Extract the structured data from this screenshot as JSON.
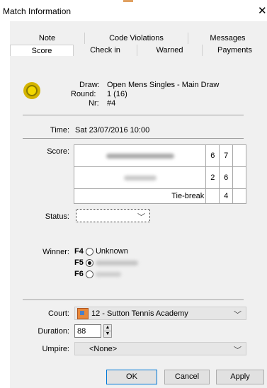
{
  "window": {
    "title": "Match Information",
    "close_glyph": "✕"
  },
  "tabs_row1": [
    {
      "label": "Note"
    },
    {
      "label": "Code Violations"
    },
    {
      "label": "Messages"
    }
  ],
  "tabs_row2": [
    {
      "label": "Score",
      "selected": true
    },
    {
      "label": "Check in"
    },
    {
      "label": "Warned"
    },
    {
      "label": "Payments"
    }
  ],
  "header": {
    "draw_label": "Draw:",
    "draw_value": "Open Mens Singles - Main Draw",
    "round_label": "Round:",
    "round_value": "1 (16)",
    "nr_label": "Nr:",
    "nr_value": "#4",
    "ball_icon": "tennis-ball-icon"
  },
  "time": {
    "label": "Time:",
    "value": "Sat 23/07/2016 10:00"
  },
  "score": {
    "label": "Score:",
    "rows": [
      {
        "set1": "6",
        "set2": "7",
        "set3": ""
      },
      {
        "set1": "2",
        "set2": "6",
        "set3": ""
      }
    ],
    "tiebreak_label": "Tie-break",
    "tiebreak_values": [
      "",
      "4",
      ""
    ]
  },
  "status": {
    "label": "Status:",
    "value": ""
  },
  "winner": {
    "label": "Winner:",
    "options": [
      {
        "key": "F4",
        "text": "Unknown",
        "checked": false
      },
      {
        "key": "F5",
        "text": "",
        "checked": true
      },
      {
        "key": "F6",
        "text": "",
        "checked": false
      }
    ]
  },
  "court": {
    "label": "Court:",
    "value": "12 - Sutton Tennis Academy",
    "icon": "court-icon"
  },
  "duration": {
    "label": "Duration:",
    "value": "88"
  },
  "umpire": {
    "label": "Umpire:",
    "value": "<None>"
  },
  "buttons": {
    "ok": "OK",
    "cancel": "Cancel",
    "apply": "Apply"
  },
  "colors": {
    "dialog_bg": "#f0f0f0",
    "accent": "#0078d7"
  }
}
